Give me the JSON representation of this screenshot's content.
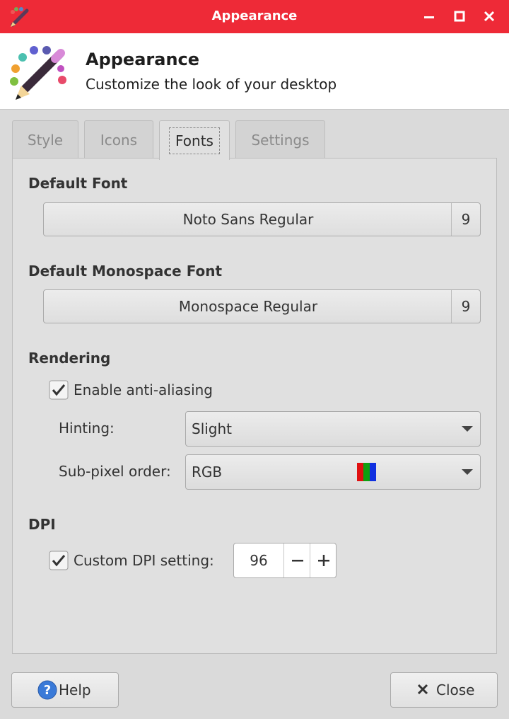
{
  "window": {
    "title": "Appearance",
    "accent_color": "#ee2a37"
  },
  "header": {
    "title": "Appearance",
    "subtitle": "Customize the look of your desktop",
    "icon": "appearance-palette-pencil-icon"
  },
  "tabs": [
    {
      "label": "Style",
      "active": false
    },
    {
      "label": "Icons",
      "active": false
    },
    {
      "label": "Fonts",
      "active": true
    },
    {
      "label": "Settings",
      "active": false
    }
  ],
  "fonts": {
    "default_font": {
      "heading": "Default Font",
      "name": "Noto Sans Regular",
      "size": "9"
    },
    "monospace_font": {
      "heading": "Default Monospace Font",
      "name": "Monospace Regular",
      "size": "9"
    },
    "rendering": {
      "heading": "Rendering",
      "antialias_label": "Enable anti-aliasing",
      "antialias_checked": true,
      "hinting_label": "Hinting:",
      "hinting_value": "Slight",
      "subpixel_label": "Sub-pixel order:",
      "subpixel_value": "RGB",
      "subpixel_swatch_colors": [
        "#e01010",
        "#10a010",
        "#1030e0"
      ]
    },
    "dpi": {
      "heading": "DPI",
      "custom_label": "Custom DPI setting:",
      "custom_checked": true,
      "value": "96"
    }
  },
  "footer": {
    "help_label": "Help",
    "close_label": "Close"
  }
}
